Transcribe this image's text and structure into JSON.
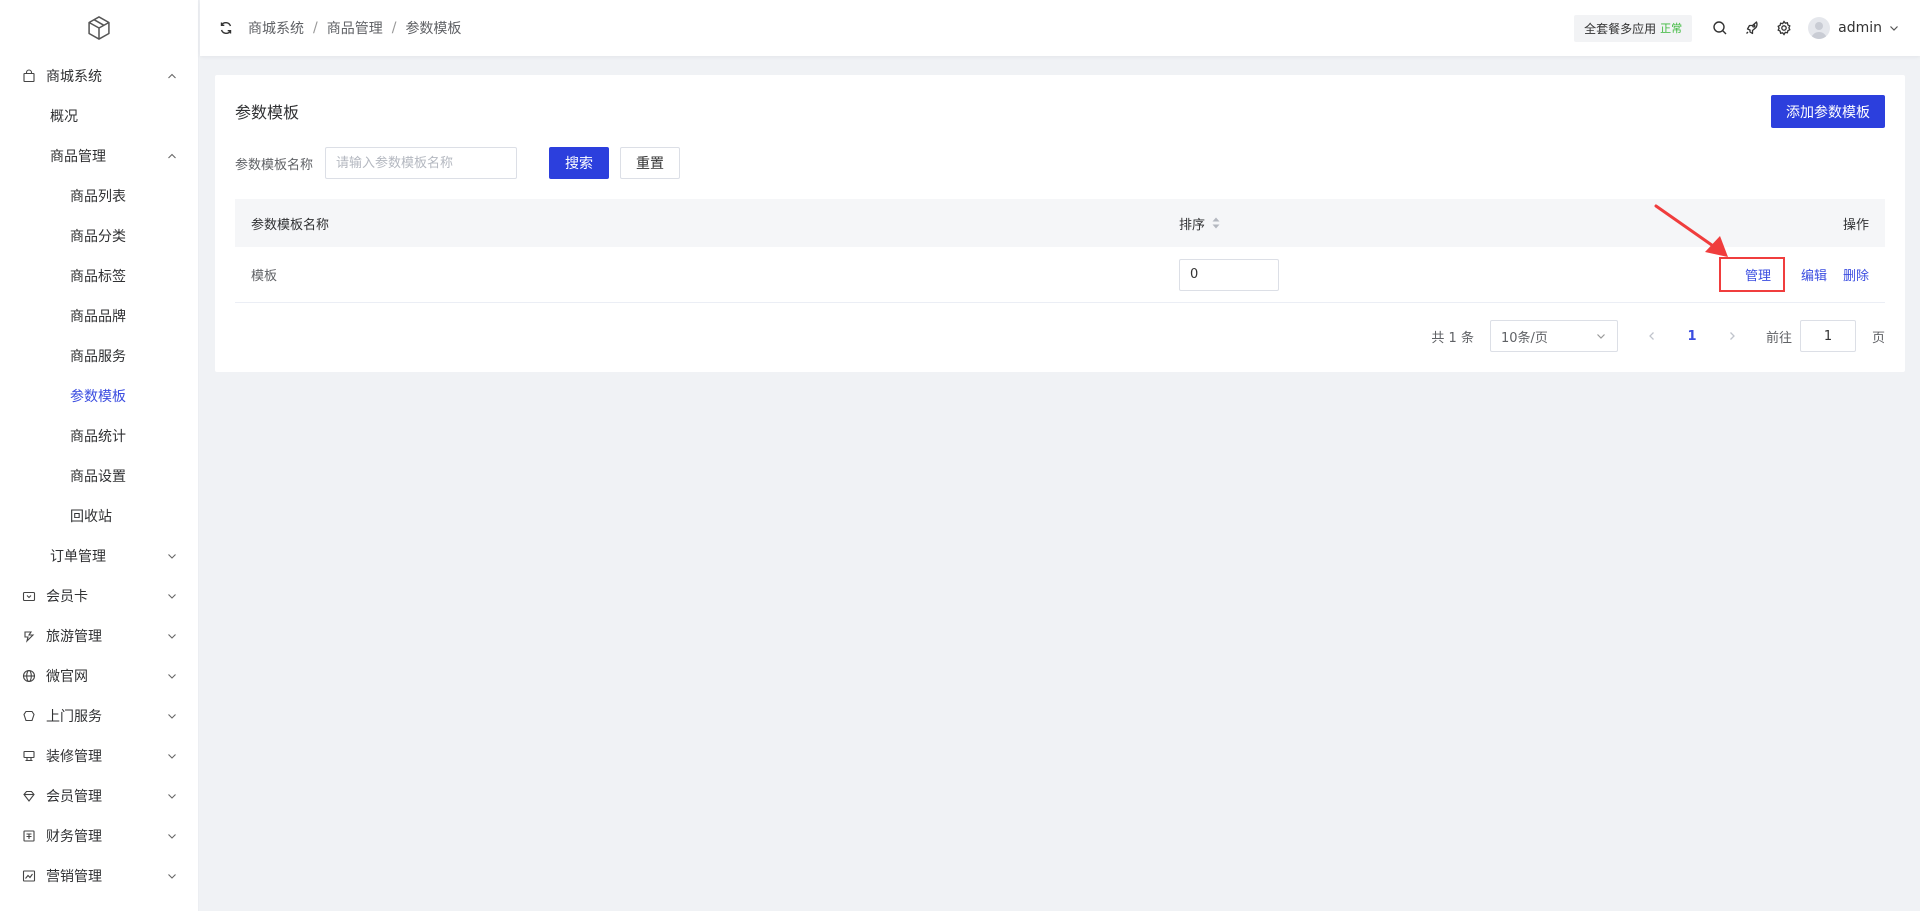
{
  "sidebar": {
    "items": [
      {
        "label": "商城系统",
        "icon": "shopping-bag-icon",
        "expanded": true
      },
      {
        "label": "概况"
      },
      {
        "label": "商品管理",
        "expanded": true
      },
      {
        "label": "商品列表"
      },
      {
        "label": "商品分类"
      },
      {
        "label": "商品标签"
      },
      {
        "label": "商品品牌"
      },
      {
        "label": "商品服务"
      },
      {
        "label": "参数模板",
        "active": true
      },
      {
        "label": "商品统计"
      },
      {
        "label": "商品设置"
      },
      {
        "label": "回收站"
      },
      {
        "label": "订单管理"
      },
      {
        "label": "会员卡",
        "icon": "card-icon"
      },
      {
        "label": "旅游管理",
        "icon": "travel-icon"
      },
      {
        "label": "微官网",
        "icon": "globe-icon"
      },
      {
        "label": "上门服务",
        "icon": "service-icon"
      },
      {
        "label": "装修管理",
        "icon": "decoration-icon"
      },
      {
        "label": "会员管理",
        "icon": "diamond-icon"
      },
      {
        "label": "财务管理",
        "icon": "finance-icon"
      },
      {
        "label": "营销管理",
        "icon": "chart-line-icon"
      }
    ]
  },
  "header": {
    "breadcrumb": [
      "商城系统",
      "商品管理",
      "参数模板"
    ],
    "plan": "全套餐多应用",
    "plan_status": "正常",
    "username": "admin"
  },
  "page": {
    "title": "参数模板",
    "add_button": "添加参数模板",
    "filter_label": "参数模板名称",
    "filter_placeholder": "请输入参数模板名称",
    "search_button": "搜索",
    "reset_button": "重置"
  },
  "table": {
    "columns": [
      "参数模板名称",
      "排序",
      "操作"
    ],
    "rows": [
      {
        "name": "模板",
        "sort": "0",
        "actions": [
          "管理",
          "编辑",
          "删除"
        ]
      }
    ]
  },
  "pagination": {
    "total": "共 1 条",
    "page_size": "10条/页",
    "current": "1",
    "goto_label": "前往",
    "goto_value": "1",
    "page_unit": "页"
  },
  "colors": {
    "primary": "#2c3fdd",
    "highlight_box": "#f03d3d"
  }
}
